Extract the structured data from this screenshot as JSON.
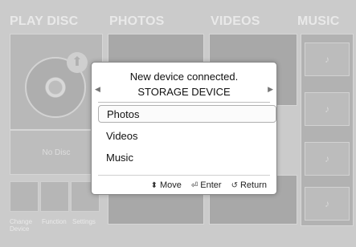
{
  "categories": [
    {
      "label": "PLAY DISC"
    },
    {
      "label": "PHOTOS"
    },
    {
      "label": "VIDEOS"
    },
    {
      "label": "MUSIC"
    }
  ],
  "disc_tile": {
    "no_disc_text": "No Disc"
  },
  "mini_tiles": [
    {
      "label": "Change Device",
      "icon": "change-device-icon"
    },
    {
      "label": "Function",
      "icon": "function-icon"
    },
    {
      "label": "Settings",
      "icon": "settings-icon"
    }
  ],
  "dialog": {
    "title": "New device connected.",
    "subtitle": "STORAGE DEVICE",
    "options": [
      {
        "label": "Photos",
        "selected": true
      },
      {
        "label": "Videos",
        "selected": false
      },
      {
        "label": "Music",
        "selected": false
      }
    ],
    "hints": [
      {
        "icon": "updown-icon",
        "glyph": "⬍",
        "label": "Move"
      },
      {
        "icon": "enter-icon",
        "glyph": "⏎",
        "label": "Enter"
      },
      {
        "icon": "return-icon",
        "glyph": "↺",
        "label": "Return"
      }
    ]
  },
  "colors": {
    "background": "#cbcbcb",
    "dialog_bg": "#ffffff",
    "text": "#111111"
  }
}
